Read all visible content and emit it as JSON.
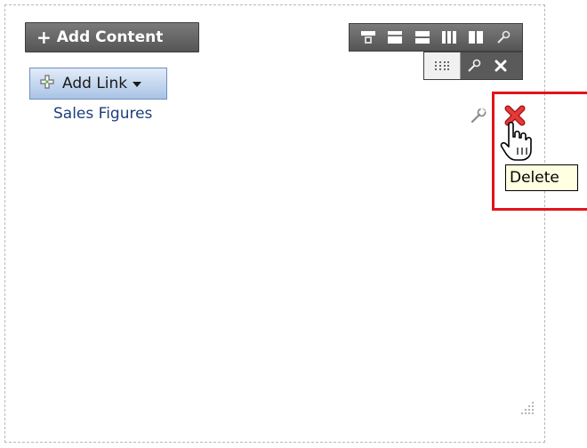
{
  "toolbar": {
    "add_content_label": "Add Content",
    "add_content_icon": "plus-icon"
  },
  "layout_toolbar": {
    "icons": [
      "move-layout-icon",
      "single-column-icon",
      "two-row-icon",
      "three-column-icon",
      "two-column-icon",
      "wrench-icon"
    ]
  },
  "region_toolbar": {
    "icons": [
      "drag-handle-icon",
      "wrench-icon",
      "close-icon"
    ]
  },
  "links": {
    "add_link_label": "Add Link",
    "items": [
      {
        "label": "Sales Figures"
      }
    ]
  },
  "tooltip": {
    "text": "Delete"
  },
  "colors": {
    "accent_highlight": "#e0141c",
    "link_text": "#1c3f7a",
    "toolbar_bg": "#5a5a5a",
    "tooltip_bg": "#ffffe1"
  }
}
